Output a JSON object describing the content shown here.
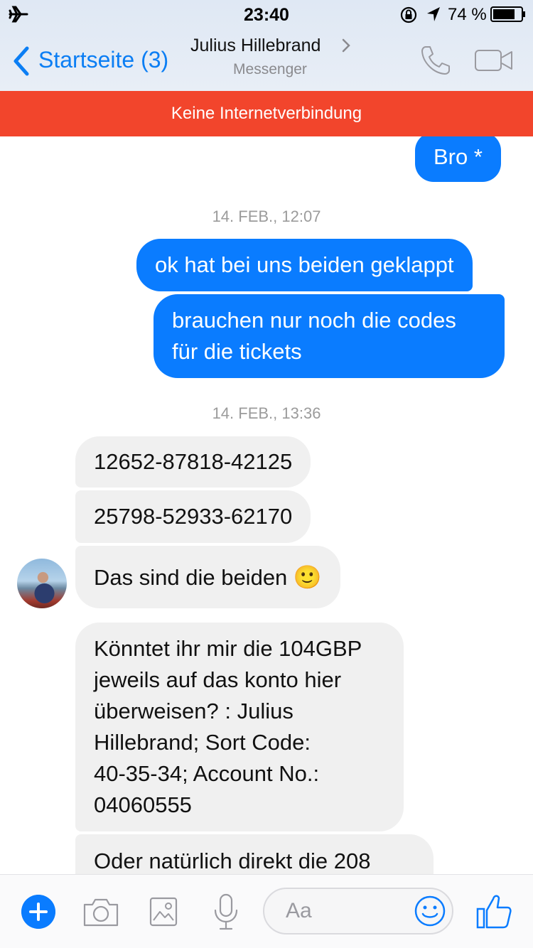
{
  "status_bar": {
    "time": "23:40",
    "battery_percent": "74 %",
    "icons": [
      "airplane-icon",
      "rotation-lock-icon",
      "location-arrow-icon",
      "battery-icon"
    ]
  },
  "nav": {
    "back_label": "Startseite (3)",
    "contact_name": "Julius Hillebrand",
    "contact_subtitle": "Messenger",
    "icons": [
      "back-chevron-icon",
      "phone-icon",
      "video-call-icon"
    ]
  },
  "banner": {
    "text": "Keine Internetverbindung",
    "color": "#f2452c"
  },
  "colors": {
    "accent": "#0a7cff",
    "incoming_bubble": "#f0f0f0",
    "timestamp": "#9b9b9b"
  },
  "messages": [
    {
      "text": "Bro *",
      "direction": "outgoing"
    },
    {
      "timestamp": "14. FEB., 12:07"
    },
    {
      "text": "ok hat bei uns beiden geklappt",
      "direction": "outgoing"
    },
    {
      "text_lines": [
        "brauchen nur noch die codes",
        "für die tickets"
      ],
      "direction": "outgoing"
    },
    {
      "timestamp": "14. FEB., 13:36"
    },
    {
      "text": "12652-87818-42125",
      "direction": "incoming"
    },
    {
      "text": "25798-52933-62170",
      "direction": "incoming"
    },
    {
      "text": "Das sind die beiden",
      "emoji": "🙂",
      "direction": "incoming"
    },
    {
      "text_lines": [
        "Könntet ihr mir die 104GBP",
        "jeweils auf das konto hier",
        "überweisen? : Julius",
        "Hillebrand; Sort Code:",
        "40-35-34; Account No.:",
        "04060555"
      ],
      "direction": "incoming"
    },
    {
      "text": "Oder natürlich direkt die 208",
      "direction": "incoming"
    }
  ],
  "composer": {
    "placeholder": "Aa",
    "icons": [
      "plus-icon",
      "camera-icon",
      "image-icon",
      "microphone-icon",
      "emoji-icon",
      "thumbs-up-icon"
    ]
  }
}
